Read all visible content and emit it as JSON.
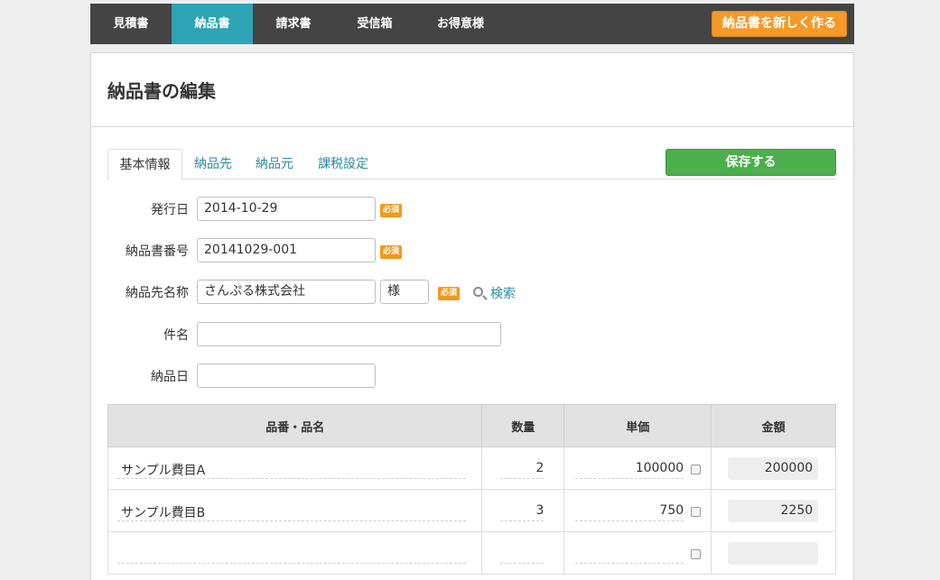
{
  "nav": {
    "tabs": [
      "見積書",
      "納品書",
      "請求書",
      "受信箱",
      "お得意様"
    ],
    "active_index": 1,
    "create_button": "納品書を新しく作る"
  },
  "page": {
    "title": "納品書の編集"
  },
  "tabs": {
    "items": [
      "基本情報",
      "納品先",
      "納品元",
      "課税設定"
    ],
    "active_index": 0,
    "save_button": "保存する"
  },
  "form": {
    "issue_date": {
      "label": "発行日",
      "value": "2014-10-29",
      "required": "必須"
    },
    "delivery_number": {
      "label": "納品書番号",
      "value": "20141029-001",
      "required": "必須"
    },
    "recipient_name": {
      "label": "納品先名称",
      "value": "さんぷる株式会社",
      "honorific": "様",
      "required": "必須",
      "search": "検索"
    },
    "subject": {
      "label": "件名",
      "value": ""
    },
    "delivery_date": {
      "label": "納品日",
      "value": ""
    }
  },
  "table": {
    "headers": [
      "品番・品名",
      "数量",
      "単価",
      "金額"
    ],
    "rows": [
      {
        "name": "サンプル費目A",
        "qty": "2",
        "price": "100000",
        "amount": "200000"
      },
      {
        "name": "サンプル費目B",
        "qty": "3",
        "price": "750",
        "amount": "2250"
      },
      {
        "name": "",
        "qty": "",
        "price": "",
        "amount": ""
      }
    ]
  },
  "colors": {
    "nav_bg": "#444444",
    "nav_active": "#2ea3b5",
    "orange": "#f39a2a",
    "green": "#4cae4c",
    "link": "#2a8da0"
  }
}
